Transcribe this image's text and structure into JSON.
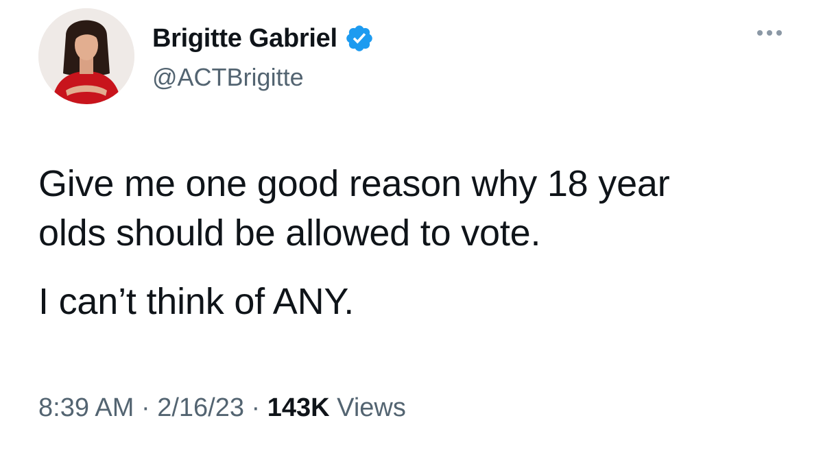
{
  "author": {
    "display_name": "Brigitte Gabriel",
    "handle": "@ACTBrigitte",
    "verified": true,
    "avatar_icon": "profile-photo"
  },
  "tweet": {
    "line1": "Give me one good reason why 18 year",
    "line2": "olds should be allowed to vote.",
    "line3": "I can’t think of ANY."
  },
  "meta": {
    "time": "8:39 AM",
    "separator": " · ",
    "date": "2/16/23",
    "views_count": "143K",
    "views_label": " Views"
  },
  "colors": {
    "verified_blue": "#1d9bf0",
    "secondary_text": "#536471",
    "primary_text": "#0f1419"
  },
  "icons": {
    "more": "more-horizontal-icon",
    "verified": "verified-badge-icon"
  }
}
